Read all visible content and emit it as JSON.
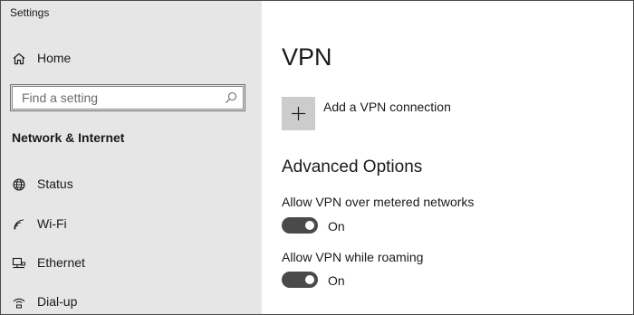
{
  "window": {
    "title": "Settings"
  },
  "sidebar": {
    "home": {
      "label": "Home",
      "icon": "home-icon"
    },
    "search": {
      "placeholder": "Find a setting",
      "icon": "search-icon"
    },
    "section_heading": "Network & Internet",
    "items": [
      {
        "label": "Status",
        "icon": "globe-icon"
      },
      {
        "label": "Wi-Fi",
        "icon": "wifi-icon"
      },
      {
        "label": "Ethernet",
        "icon": "ethernet-icon"
      },
      {
        "label": "Dial-up",
        "icon": "dialup-icon"
      }
    ]
  },
  "main": {
    "title": "VPN",
    "add_vpn": {
      "label": "Add a VPN connection",
      "icon": "plus-icon"
    },
    "advanced": {
      "heading": "Advanced Options",
      "settings": [
        {
          "label": "Allow VPN over metered networks",
          "enabled": true,
          "state_label": "On"
        },
        {
          "label": "Allow VPN while roaming",
          "enabled": true,
          "state_label": "On"
        }
      ]
    }
  },
  "colors": {
    "sidebar_bg": "#e6e6e6",
    "toggle_on": "#4a4a4a",
    "tile_bg": "#cccccc",
    "text": "#1a1a1a"
  }
}
